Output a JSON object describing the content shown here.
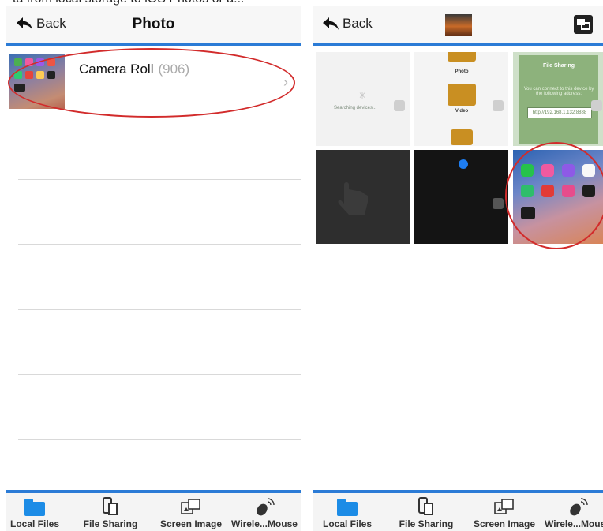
{
  "top_cut_text": "ta from local storage to iOS Photos or a...",
  "left_screen": {
    "back_label": "Back",
    "title": "Photo",
    "album": {
      "name": "Camera Roll",
      "count": "(906)"
    }
  },
  "right_screen": {
    "back_label": "Back",
    "tiles": {
      "searching": "Searching devices...",
      "folder_photo": "Photo",
      "folder_video": "Video",
      "file_sharing_title": "File Sharing",
      "file_sharing_desc": "You can connect to this device by the following address:",
      "file_sharing_addr": "http://192.168.1.132:8888"
    }
  },
  "tabbar": {
    "local_files": "Local Files",
    "file_sharing": "File Sharing",
    "screen_image": "Screen Image",
    "wireless_mouse": "Wirele...Mouse"
  },
  "colors": {
    "accent": "#2b7bd6",
    "annotation": "#d22b2b",
    "folder": "#1c8ce6"
  }
}
